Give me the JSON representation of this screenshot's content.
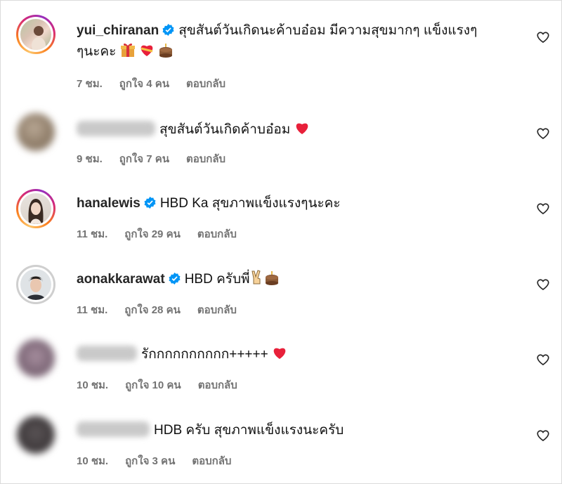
{
  "comments": [
    {
      "username": "yui_chiranan",
      "verified": true,
      "text_line1": "สุขสันต์วันเกิดนะค้าบอ๋อม มีความสุขมากๆ แข็งแรงๆ",
      "text_line2": "ๆนะคะ",
      "time": "7 ชม.",
      "likes": "ถูกใจ 4 คน",
      "reply": "ตอบกลับ",
      "emojis": [
        "gift-emoji",
        "heart-ribbon-emoji",
        "cake-emoji"
      ]
    },
    {
      "username": "",
      "verified": false,
      "text_line1": "สุขสันต์วันเกิดค้าบอ๋อม",
      "time": "9 ชม.",
      "likes": "ถูกใจ 7 คน",
      "reply": "ตอบกลับ",
      "emojis": [
        "red-heart-emoji"
      ]
    },
    {
      "username": "hanalewis",
      "verified": true,
      "text_line1": "HBD Ka สุขภาพแข็งแรงๆนะคะ",
      "time": "11 ชม.",
      "likes": "ถูกใจ 29 คน",
      "reply": "ตอบกลับ"
    },
    {
      "username": "aonakkarawat",
      "verified": true,
      "text_line1": "HBD ครับพี่",
      "time": "11 ชม.",
      "likes": "ถูกใจ 28 คน",
      "reply": "ตอบกลับ",
      "emojis": [
        "victory-hand-emoji",
        "cake-emoji"
      ]
    },
    {
      "username": "",
      "verified": false,
      "text_line1": "รักกกกกกกกกก+++++",
      "time": "10 ชม.",
      "likes": "ถูกใจ 10 คน",
      "reply": "ตอบกลับ",
      "emojis": [
        "red-heart-emoji"
      ]
    },
    {
      "username": "",
      "verified": false,
      "text_line1": "HDB ครับ สุขภาพแข็งแรงนะครับ",
      "time": "10 ชม.",
      "likes": "ถูกใจ 3 คน",
      "reply": "ตอบกลับ"
    }
  ],
  "colors": {
    "verified_blue": "#0095f6",
    "meta_grey": "#737373",
    "heart_red": "#e8203a"
  }
}
